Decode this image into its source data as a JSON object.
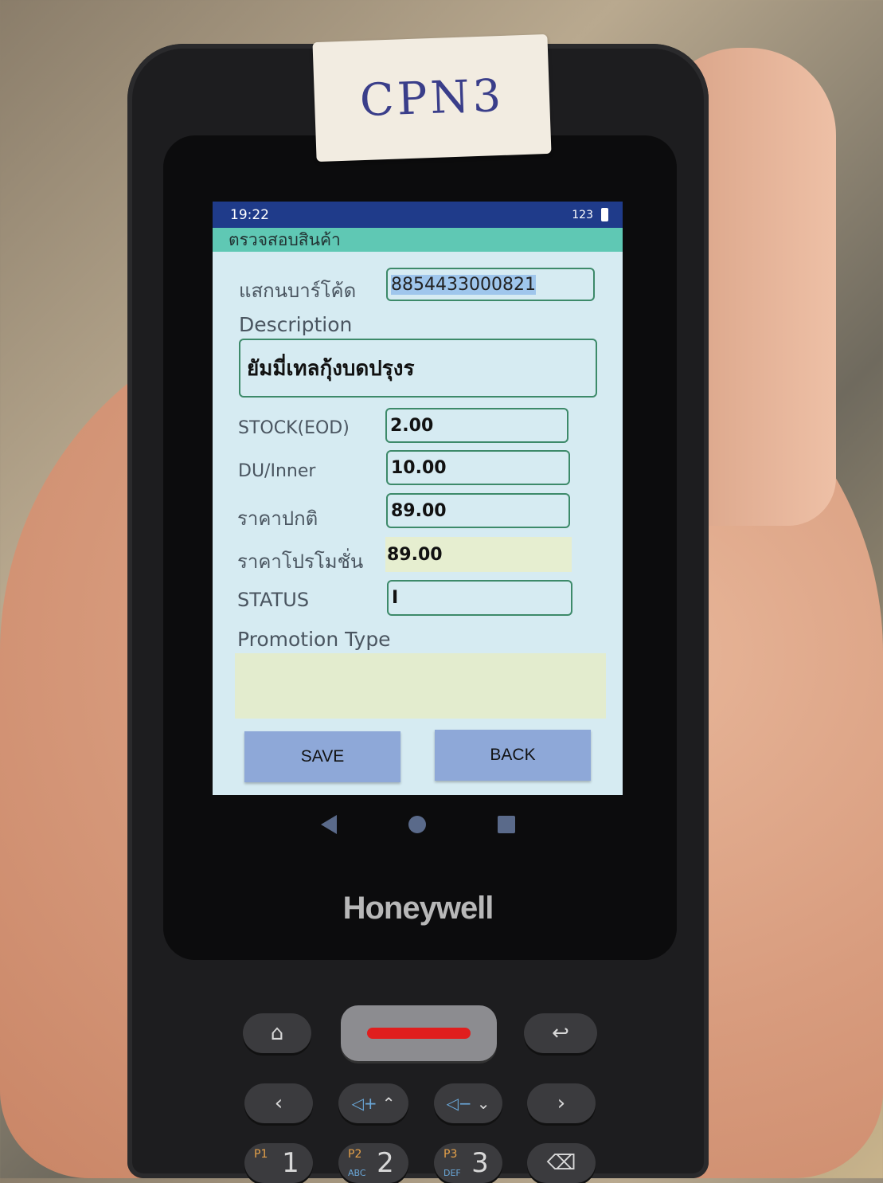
{
  "device": {
    "tag_text": "CPN3",
    "brand": "Honeywell"
  },
  "statusbar": {
    "time": "19:22",
    "input_mode": "123"
  },
  "app": {
    "title": "ตรวจสอบสินค้า",
    "barcode_label": "แสกนบาร์โค้ด",
    "barcode_value": "8854433000821",
    "description_label": "Description",
    "description_value": "ยัมมี่เทลกุ้งบดปรุงร",
    "stock_label": "STOCK(EOD)",
    "stock_value": "2.00",
    "du_label": "DU/Inner",
    "du_value": "10.00",
    "normal_price_label": "ราคาปกติ",
    "normal_price_value": "89.00",
    "promo_price_label": "ราคาโปรโมชั่น",
    "promo_price_value": "89.00",
    "status_label": "STATUS",
    "status_value": "I",
    "promo_type_label": "Promotion Type",
    "promo_type_value": "",
    "save_label": "SAVE",
    "back_label": "BACK"
  },
  "keys": {
    "p1": "P1",
    "one": "1",
    "p2": "P2",
    "abc": "ABC",
    "two": "2",
    "p3": "P3",
    "def": "DEF",
    "three": "3"
  },
  "colors": {
    "statusbar": "#1f3b8a",
    "titlebar": "#5fc8b4",
    "screen_bg": "#d6ebf2",
    "button": "#8ea8d8",
    "field_border": "#3d8a6a"
  }
}
